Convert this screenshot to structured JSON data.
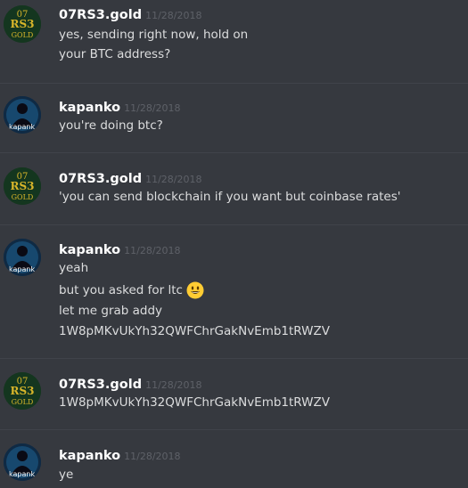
{
  "messages": [
    {
      "author": "07RS3.gold",
      "timestamp": "11/28/2018",
      "avatar_icon": "07rs3-gold-logo",
      "lines": [
        "yes, sending right now, hold on",
        "your BTC address?"
      ]
    },
    {
      "author": "kapanko",
      "timestamp": "11/28/2018",
      "avatar_icon": "kapanko-avatar",
      "lines": [
        "you're doing btc?"
      ]
    },
    {
      "author": "07RS3.gold",
      "timestamp": "11/28/2018",
      "avatar_icon": "07rs3-gold-logo",
      "lines": [
        "'you can send blockchain if you want but coinbase rates'"
      ]
    },
    {
      "author": "kapanko",
      "timestamp": "11/28/2018",
      "avatar_icon": "kapanko-avatar",
      "lines": [
        "yeah",
        "but you asked for ltc",
        "let me grab addy",
        "1W8pMKvUkYh32QWFChrGakNvEmb1tRWZV"
      ],
      "emoji": "smiley-face-emoji"
    },
    {
      "author": "07RS3.gold",
      "timestamp": "11/28/2018",
      "avatar_icon": "07rs3-gold-logo",
      "lines": [
        "1W8pMKvUkYh32QWFChrGakNvEmb1tRWZV"
      ]
    },
    {
      "author": "kapanko",
      "timestamp": "11/28/2018",
      "avatar_icon": "kapanko-avatar",
      "lines": [
        "ye"
      ]
    }
  ],
  "avatar_text": {
    "gold": [
      "07",
      "RS3",
      "GOLD"
    ],
    "kapanko": "kapank"
  },
  "colors": {
    "background": "#36393f",
    "username": "#ffffff",
    "text": "#dcddde",
    "timestamp": "#5e6168",
    "gold_logo": "#d8b52a"
  }
}
